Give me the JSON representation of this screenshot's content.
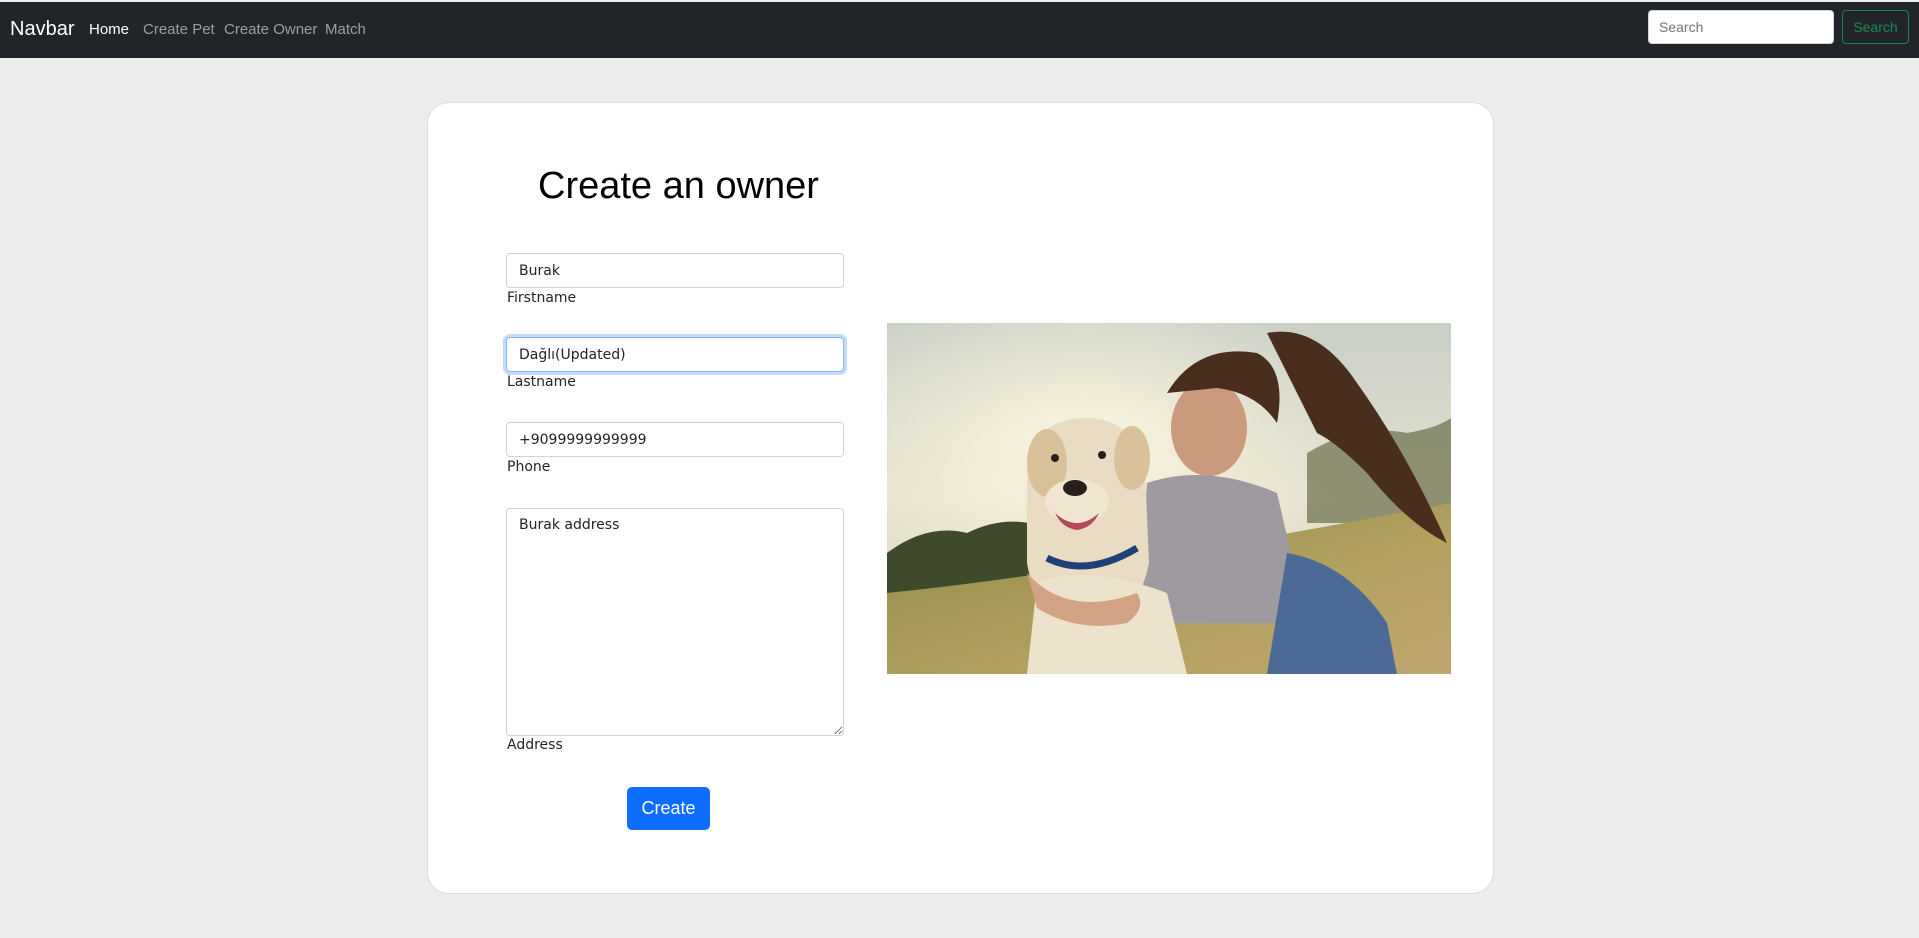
{
  "navbar": {
    "brand": "Navbar",
    "links": [
      "Home",
      "Create Pet",
      "Create Owner",
      "Match"
    ],
    "active_link": "Home",
    "search_placeholder": "Search",
    "search_button": "Search"
  },
  "form": {
    "title": "Create an owner",
    "firstname": {
      "value": "Burak",
      "label": "Firstname"
    },
    "lastname": {
      "value": "Dağlı(Updated)",
      "label": "Lastname"
    },
    "phone": {
      "value": "+9099999999999",
      "label": "Phone"
    },
    "address": {
      "value": "Burak address",
      "label": "Address"
    },
    "submit_label": "Create"
  },
  "image": {
    "subject": "woman-hugging-labrador-dog-photo"
  },
  "colors": {
    "navbar_bg": "#212529",
    "page_bg": "#ececec",
    "primary": "#0d6efd",
    "success": "#198754"
  }
}
